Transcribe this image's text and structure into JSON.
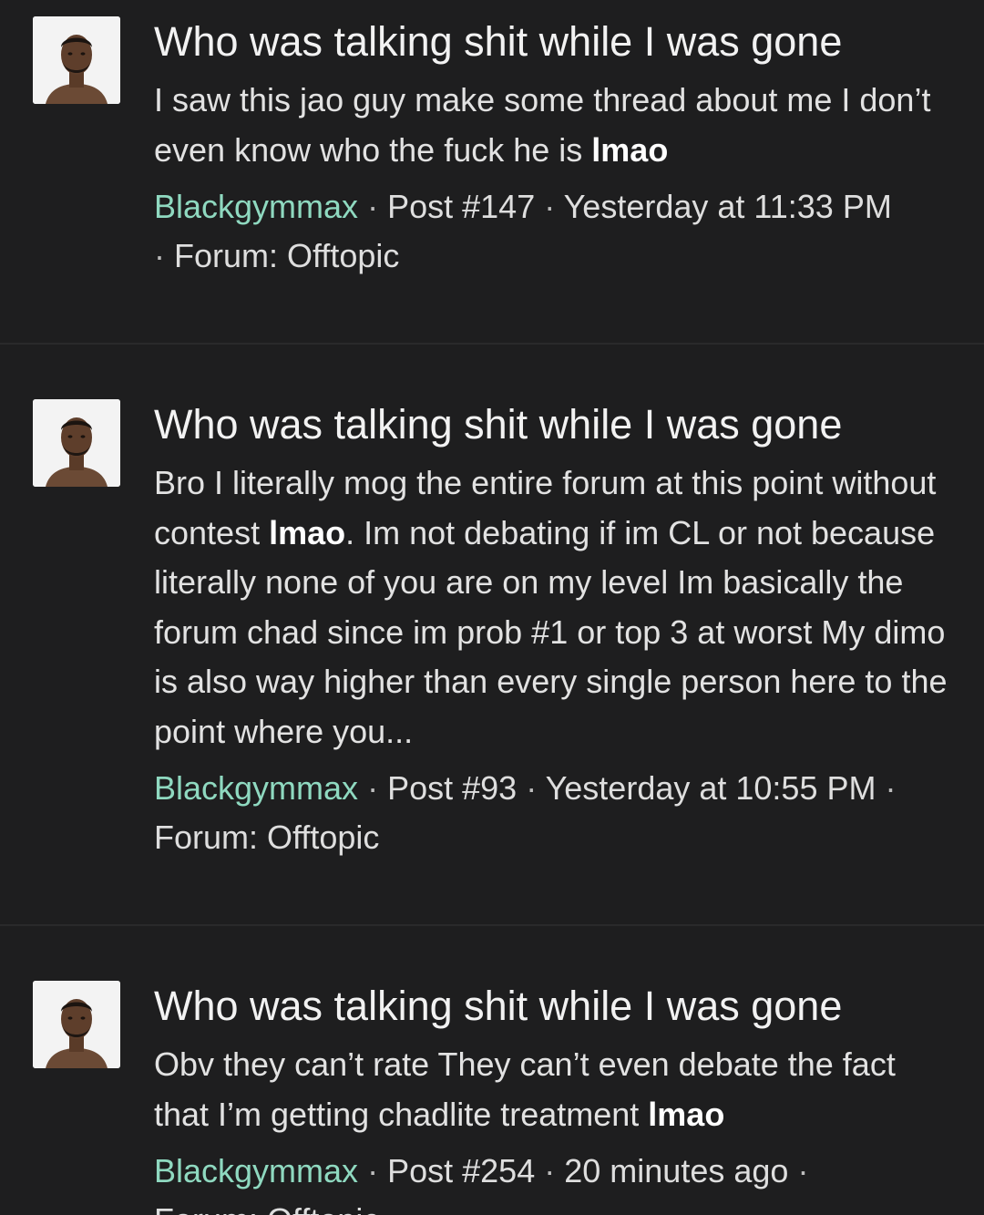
{
  "results": [
    {
      "title": "Who was talking shit while I was gone",
      "snippet_text": "I saw this jao guy make some thread about me I don’t even know who the fuck he is ",
      "snippet_bold": "lmao",
      "snippet_tail": "",
      "username": "Blackgymmax",
      "post": "Post #147",
      "time": "Yesterday at 11:33 PM",
      "forum": "Forum: Offtopic"
    },
    {
      "title": "Who was talking shit while I was gone",
      "snippet_text": "Bro I literally mog the entire forum at this point without contest ",
      "snippet_bold": "lmao",
      "snippet_tail": ". Im not debating if im CL or not because literally none of you are on my level Im basically the forum chad since im prob #1 or top 3 at worst My dimo is also way higher than every single person here to the point where you...",
      "username": "Blackgymmax",
      "post": "Post #93",
      "time": "Yesterday at 10:55 PM",
      "forum": "Forum: Offtopic"
    },
    {
      "title": "Who was talking shit while I was gone",
      "snippet_text": "Obv they can’t rate They can’t even debate the fact that I’m getting chadlite treatment ",
      "snippet_bold": "lmao",
      "snippet_tail": "",
      "username": "Blackgymmax",
      "post": "Post #254",
      "time": "20 minutes ago",
      "forum": "Forum: Offtopic"
    }
  ],
  "separator": "·",
  "icons": {
    "avatar": "user-avatar-photo"
  },
  "colors": {
    "background": "#1e1e1f",
    "username": "#8fd9c0",
    "divider": "#2a2a2b"
  }
}
